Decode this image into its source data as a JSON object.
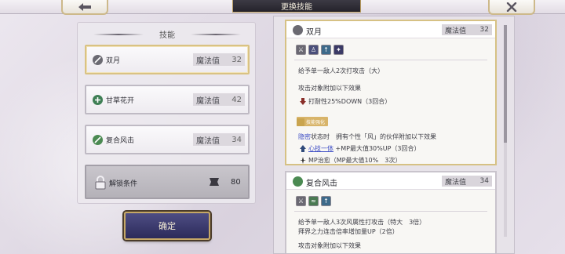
{
  "header": {
    "title": "更换技能"
  },
  "left_panel": {
    "header": "技能",
    "skills": [
      {
        "name": "双月",
        "mp_label": "魔法值",
        "mp": "32",
        "selected": true
      },
      {
        "name": "甘草花开",
        "mp_label": "魔法值",
        "mp": "42",
        "selected": false
      },
      {
        "name": "复合风击",
        "mp_label": "魔法值",
        "mp": "34",
        "selected": false
      }
    ],
    "locked": {
      "name": "解锁条件",
      "value": "80"
    }
  },
  "confirm_label": "确定",
  "details": [
    {
      "name": "双月",
      "mp_label": "魔法值",
      "mp": "32",
      "desc": "给予单一敌人2次打攻击（大）",
      "effect_title": "攻击对象附加以下效果",
      "effect_1": "打耐性25%DOWN（3回合）",
      "badge": "技能强化",
      "hidden_label": "隐密",
      "hidden_text": "状态时　拥有个性「风」的伙伴附加以下效果",
      "link_text": "心技一体",
      "link_suffix": " +MP最大值30%UP（3回合）",
      "effect_2": "MP治愈（MP最大值10%　3次）"
    },
    {
      "name": "复合风击",
      "mp_label": "魔法值",
      "mp": "34",
      "desc_1": "给予单一敌人3次风属性打攻击（特大　3倍）",
      "desc_2": "拜界之力连击倍率增加量UP（2倍）",
      "desc_3": "攻击对象附加以下效果"
    }
  ],
  "colors": {
    "accent_gold": "#d6c184",
    "confirm_bg": "#3a3970",
    "link": "#3b4bc4"
  }
}
